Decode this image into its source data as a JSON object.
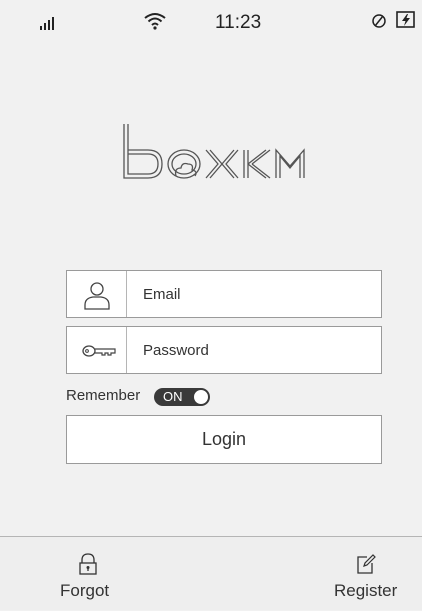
{
  "status_bar": {
    "time": "11:23",
    "icons": [
      "signal-icon",
      "wifi-icon",
      "rotation-lock-icon",
      "battery-charging-icon"
    ]
  },
  "logo": {
    "text": "boxkm"
  },
  "login_form": {
    "email_label": "Email",
    "password_label": "Password",
    "remember_label": "Remember",
    "remember_toggle_state": "ON",
    "login_button_label": "Login"
  },
  "bottom_bar": {
    "forgot_label": "Forgot",
    "register_label": "Register"
  },
  "colors": {
    "background": "#f1f1f1",
    "border": "#9a9a9a",
    "toggle_bg": "#3a3a3a",
    "text": "#333333"
  }
}
